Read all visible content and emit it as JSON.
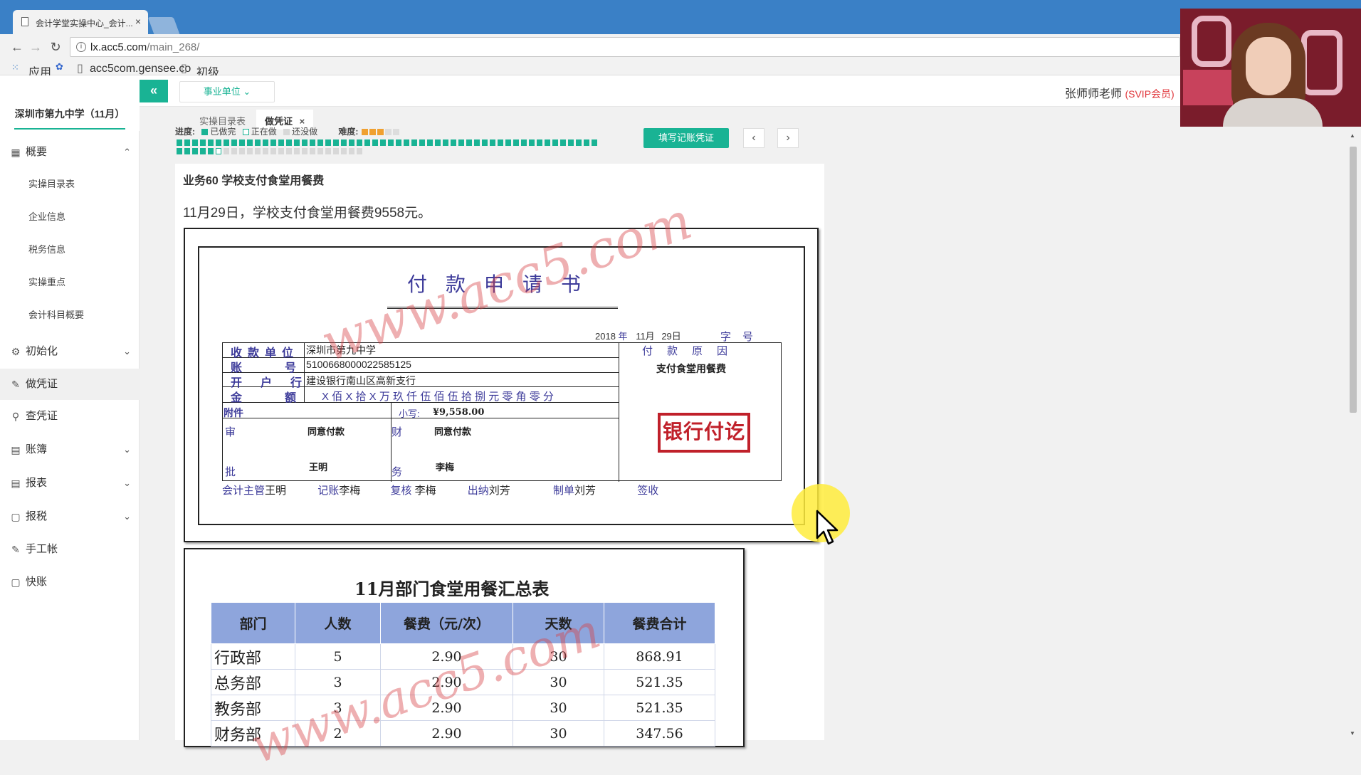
{
  "browser": {
    "tab_title": "会计学堂实操中心_会计...",
    "url_host": "lx.acc5.com",
    "url_path": "/main_268/",
    "bookmarks": [
      "应用",
      "acc5com.gensee.co",
      "初级"
    ]
  },
  "header": {
    "company": "深圳市第九中学（11月）",
    "collapse_label": "«",
    "unit_select": "事业单位",
    "teacher": "张师师老师",
    "vip": "(SVIP会员)"
  },
  "subtabs": [
    "实操目录表",
    "做凭证"
  ],
  "sidebar": {
    "items": [
      {
        "label": "概要",
        "icon": "grid-icon",
        "glyph": "▦",
        "chevron": "⌃"
      },
      {
        "label": "初始化",
        "icon": "gear-icon",
        "glyph": "⚙",
        "chevron": "⌄"
      },
      {
        "label": "做凭证",
        "icon": "pencil-icon",
        "glyph": "✎",
        "chevron": ""
      },
      {
        "label": "查凭证",
        "icon": "search-icon",
        "glyph": "⚲",
        "chevron": ""
      },
      {
        "label": "账簿",
        "icon": "book-icon",
        "glyph": "▤",
        "chevron": "⌄"
      },
      {
        "label": "报表",
        "icon": "report-icon",
        "glyph": "▤",
        "chevron": "⌄"
      },
      {
        "label": "报税",
        "icon": "doc-icon",
        "glyph": "▢",
        "chevron": "⌄"
      },
      {
        "label": "手工帐",
        "icon": "pencil-icon",
        "glyph": "✎",
        "chevron": ""
      },
      {
        "label": "快账",
        "icon": "doc-icon",
        "glyph": "▢",
        "chevron": ""
      }
    ],
    "sub_items": [
      "实操目录表",
      "企业信息",
      "税务信息",
      "实操重点",
      "会计科目概要"
    ]
  },
  "progress": {
    "label": "进度:",
    "done": "已做完",
    "doing": "正在做",
    "todo": "还没做",
    "difficulty": "难度:",
    "difficulty_level": 3,
    "difficulty_max": 5,
    "done_count": 59,
    "total": 78,
    "current": 60,
    "colors": {
      "done": "#19b394",
      "doing": "#ffffff",
      "todo": "#d8d8d8"
    }
  },
  "actions": {
    "fill_voucher": "填写记账凭证",
    "prev": "‹",
    "next": "›"
  },
  "task": {
    "title": "业务60 学校支付食堂用餐费",
    "description": "11月29日，学校支付食堂用餐费9558元。"
  },
  "voucher": {
    "title": "付款申请书",
    "year": "2018",
    "year_label": "年",
    "month": "11月",
    "day": "29日",
    "zi_hao": "字号",
    "reason_label": "付款原因",
    "reason": "支付食堂用餐费",
    "rows": [
      {
        "label": "收款单位",
        "value": "深圳市第九中学"
      },
      {
        "label": "账号",
        "value": "510066800002258512​5"
      },
      {
        "label": "开户行",
        "value": "建设银行南山区高新支行"
      },
      {
        "label": "金额",
        "value": "X 佰 X 拾 X 万 玖 仟 伍 佰 伍 拾 捌 元 零 角 零 分"
      }
    ],
    "attachment_label": "附件",
    "small_label": "小写:",
    "small_amount": "¥9,558.00",
    "approve_label_top": "审",
    "approve_label_bottom": "批",
    "approve_text": "同意付款",
    "approver": "王明",
    "finance_label_top": "财",
    "finance_label_bottom": "务",
    "finance_text": "同意付款",
    "finance_person": "李梅",
    "sign_row": {
      "supervisor_label": "会计主管",
      "supervisor": "王明",
      "bookkeeper_label": "记账",
      "bookkeeper": "李梅",
      "reviewer_label": "复核",
      "reviewer": "李梅",
      "cashier_label": "出纳",
      "cashier": "刘芳",
      "maker_label": "制单",
      "maker": "刘芳",
      "receiver_label": "签收"
    },
    "stamp": "银行付讫",
    "watermark": "www.acc5.com"
  },
  "summary": {
    "title": "11月部门食堂用餐汇总表",
    "columns": [
      "部门",
      "人数",
      "餐费（元/次）",
      "天数",
      "餐费合计"
    ],
    "rows": [
      [
        "行政部",
        "5",
        "2.90",
        "30",
        "868.91"
      ],
      [
        "总务部",
        "3",
        "2.90",
        "30",
        "521.35"
      ],
      [
        "教务部",
        "3",
        "2.90",
        "30",
        "521.35"
      ],
      [
        "财务部",
        "2",
        "2.90",
        "30",
        "347.56"
      ]
    ],
    "watermark": "www.acc5.com"
  }
}
